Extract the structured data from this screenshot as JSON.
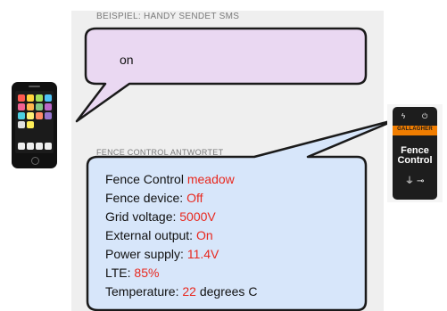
{
  "request": {
    "section_label": "BEISPIEL: HANDY SENDET SMS",
    "message": "on"
  },
  "reply": {
    "section_label": "FENCE CONTROL ANTWORTET",
    "lines": [
      {
        "label": "Fence Control ",
        "value": "meadow",
        "suffix": ""
      },
      {
        "label": "Fence device: ",
        "value": "Off",
        "suffix": ""
      },
      {
        "label": "Grid voltage: ",
        "value": "5000V",
        "suffix": ""
      },
      {
        "label": "External output: ",
        "value": "On",
        "suffix": ""
      },
      {
        "label": "Power supply: ",
        "value": "11.4V",
        "suffix": ""
      },
      {
        "label": "LTE: ",
        "value": "85%",
        "suffix": ""
      },
      {
        "label": "Temperature: ",
        "value": "22",
        "suffix": " degrees C"
      }
    ]
  },
  "device": {
    "brand": "GALLAGHER",
    "name_line1": "Fence",
    "name_line2": "Control"
  },
  "colors": {
    "request_bubble_fill": "#ead8f2",
    "reply_bubble_fill": "#d7e6fa",
    "highlight_value": "#e8281e",
    "device_accent": "#f07d00"
  }
}
